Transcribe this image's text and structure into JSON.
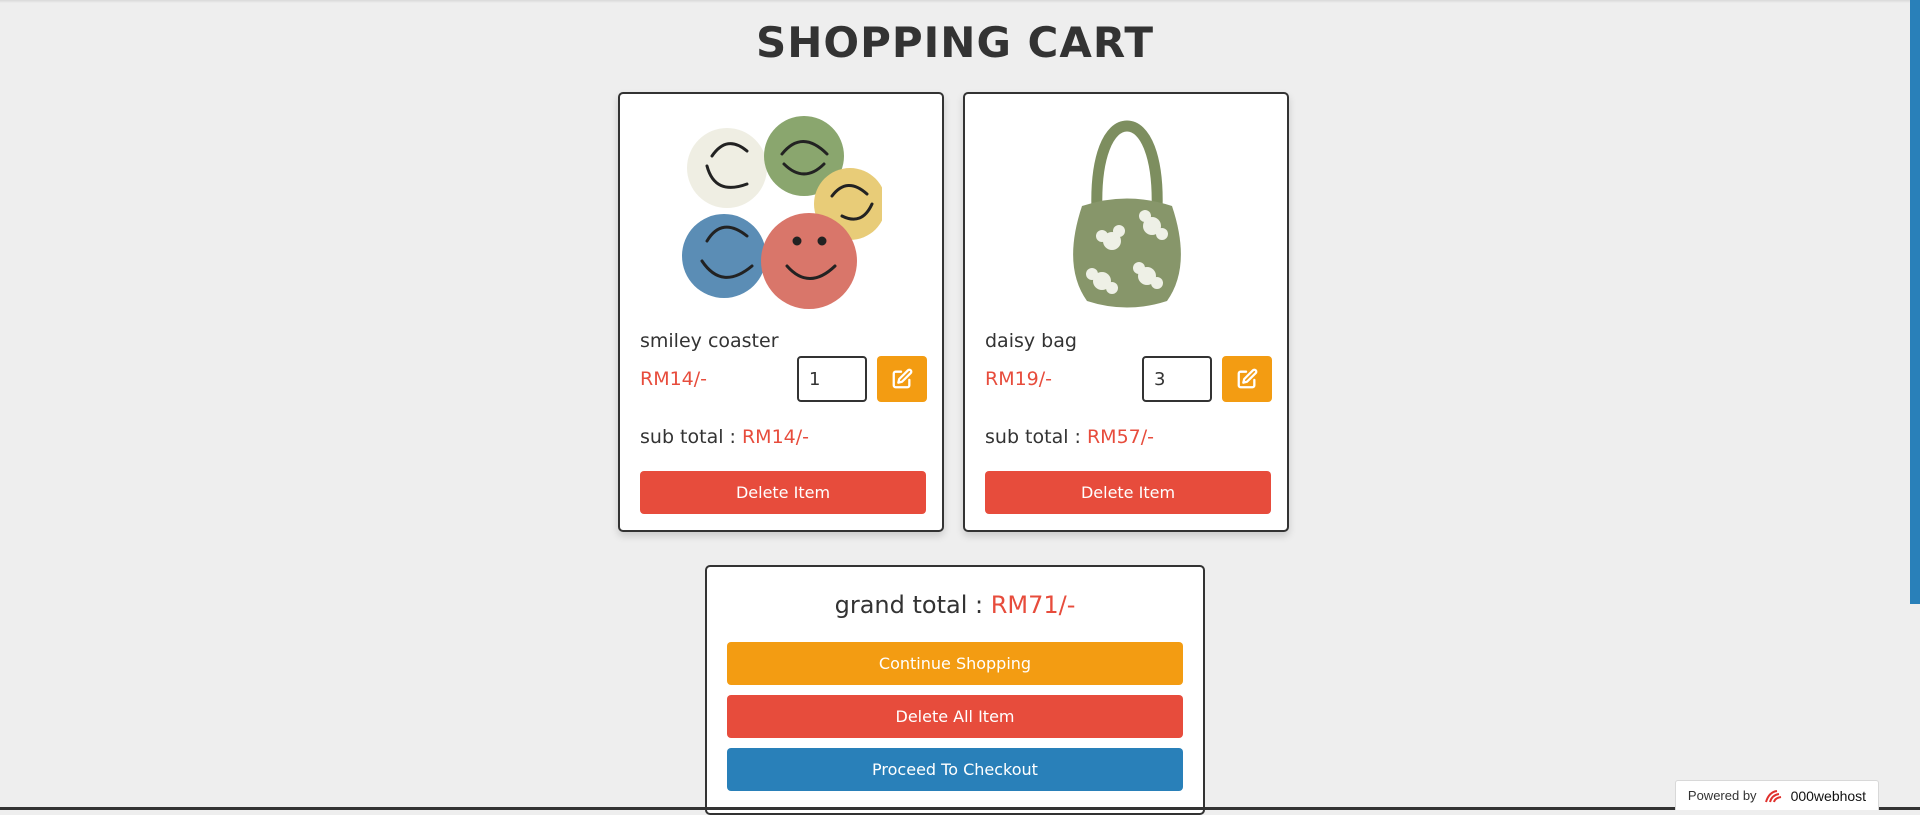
{
  "page": {
    "title": "SHOPPING CART"
  },
  "cart": {
    "items": [
      {
        "name": "smiley coaster",
        "price": "RM14/-",
        "quantity": "1",
        "subtotal_label": "sub total : ",
        "subtotal": "RM14/-",
        "delete_label": "Delete Item",
        "image_icon": "crochet-coasters-image"
      },
      {
        "name": "daisy bag",
        "price": "RM19/-",
        "quantity": "3",
        "subtotal_label": "sub total : ",
        "subtotal": "RM57/-",
        "delete_label": "Delete Item",
        "image_icon": "crochet-bag-image"
      }
    ]
  },
  "summary": {
    "grand_total_label": "grand total : ",
    "grand_total": "RM71/-",
    "continue_label": "Continue Shopping",
    "delete_all_label": "Delete All Item",
    "checkout_label": "Proceed To Checkout"
  },
  "footer_badge": {
    "powered_by": "Powered by",
    "brand": "000webhost"
  },
  "colors": {
    "accent_orange": "#f39c12",
    "danger_red": "#e74c3c",
    "primary_blue": "#2980b9",
    "background": "#eeeeee",
    "text": "#333333"
  }
}
